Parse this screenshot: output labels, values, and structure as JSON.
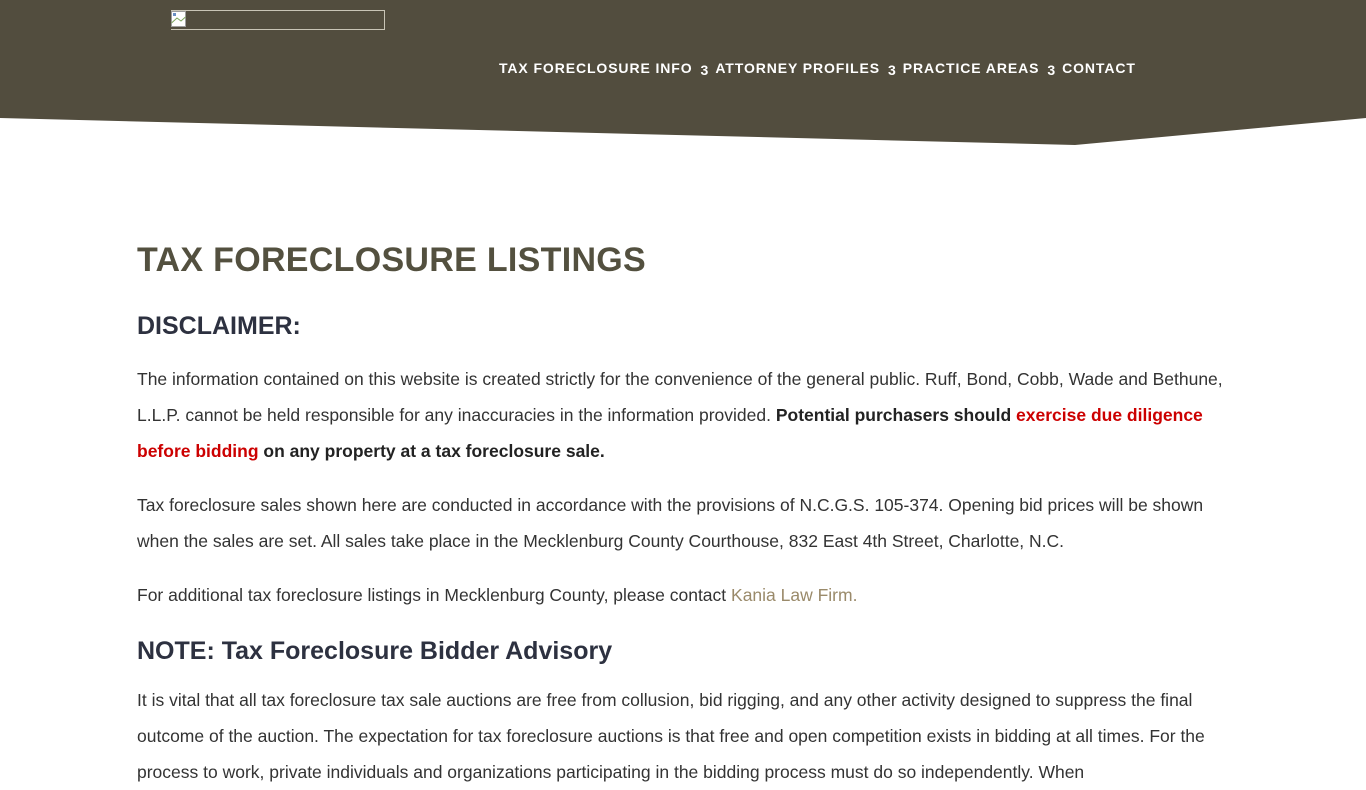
{
  "colors": {
    "header_bg": "#524d3e",
    "title": "#53503f",
    "heading": "#2d3140",
    "body_text": "#333333",
    "emphasis_red": "#cc0000",
    "link": "#9a8a6a"
  },
  "header": {
    "logo_icon": "broken-image-icon",
    "nav": [
      {
        "label": "TAX FORECLOSURE INFO",
        "separator": "3"
      },
      {
        "label": "ATTORNEY PROFILES",
        "separator": "3"
      },
      {
        "label": "PRACTICE AREAS",
        "separator": "3"
      },
      {
        "label": "CONTACT"
      }
    ]
  },
  "main": {
    "title": "TAX FORECLOSURE LISTINGS",
    "disclaimer_heading": "DISCLAIMER:",
    "p1": {
      "text": "The information contained on this website is created strictly for the convenience of the general public. Ruff, Bond, Cobb, Wade and Bethune, L.L.P. cannot be held responsible for any inaccuracies in the information provided. ",
      "bold_start": "Potential purchasers should ",
      "red": "exercise due diligence before bidding",
      "bold_end": " on any property at a tax foreclosure sale."
    },
    "p2": "Tax foreclosure sales shown here are conducted in accordance with the provisions of N.C.G.S. 105-374. Opening bid prices will be shown when the sales are set. All sales take place in the Mecklenburg County Courthouse, 832 East 4th Street, Charlotte, N.C.",
    "p3": {
      "text": "For additional tax foreclosure listings in Mecklenburg County, please contact ",
      "link": "Kania Law Firm."
    },
    "note_heading": "NOTE: Tax Foreclosure Bidder Advisory",
    "p4": "It is vital that all tax foreclosure tax sale auctions are free from collusion, bid rigging, and any other activity designed to suppress the final outcome of the auction.  The expectation for tax foreclosure auctions is that free and open competition exists in bidding at all times.  For the process to work, private individuals and organizations participating in the bidding process must do so independently. When"
  }
}
